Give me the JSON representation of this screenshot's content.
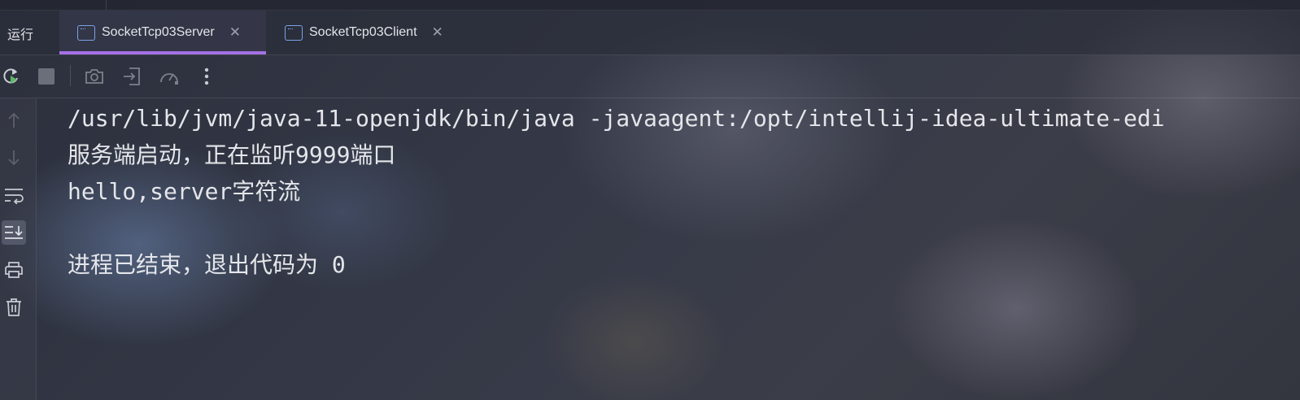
{
  "panel": {
    "title": "运行"
  },
  "tabs": [
    {
      "label": "SocketTcp03Server",
      "active": true
    },
    {
      "label": "SocketTcp03Client",
      "active": false
    }
  ],
  "toolbar": {
    "icons": [
      "rerun-icon",
      "stop-icon",
      "camera-icon",
      "login-icon",
      "dashboard-icon",
      "more-icon"
    ]
  },
  "gutter": {
    "icons": [
      "arrow-up-icon",
      "arrow-down-icon",
      "soft-wrap-icon",
      "scroll-to-end-icon",
      "print-icon",
      "trash-icon"
    ]
  },
  "console": {
    "lines": [
      "/usr/lib/jvm/java-11-openjdk/bin/java -javaagent:/opt/intellij-idea-ultimate-edi",
      "服务端启动，正在监听9999端口",
      "hello,server字符流",
      "",
      "进程已结束，退出代码为 0"
    ]
  },
  "colors": {
    "accent": "#a571e6",
    "text": "#e4e6ea",
    "icon": "#9aa0ab",
    "run_green": "#5fb865"
  }
}
